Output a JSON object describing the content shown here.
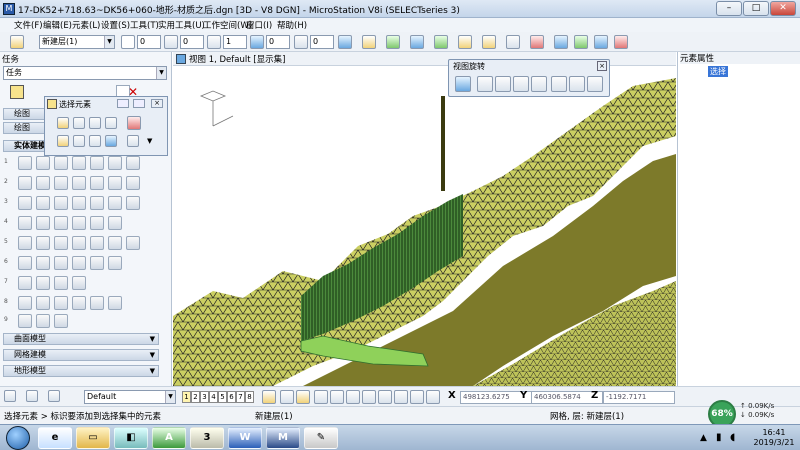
{
  "window": {
    "title": "17-DK52+718.63~DK56+060-地形-材质之后.dgn [3D - V8 DGN] - MicroStation V8i (SELECTseries 3)",
    "min": "–",
    "max": "□",
    "close": "✕"
  },
  "menu": [
    "文件(F)",
    "编辑(E)",
    "元素(L)",
    "设置(S)",
    "工具(T)",
    "实用工具(U)",
    "工作空间(W)",
    "窗口(I)",
    "帮助(H)"
  ],
  "toolbar": {
    "level_combo": "新建层(1)",
    "color_val": "0",
    "style_val": "0",
    "weight_val": "1",
    "transp_val": "0",
    "prio_val": "0"
  },
  "tasks": {
    "header": "任务",
    "combo": "任务",
    "groups": [
      "绘图",
      "绘图",
      "实体建模"
    ],
    "bottom_groups": [
      "曲面模型",
      "网格建模",
      "地形模型"
    ],
    "row_numbers": [
      "1",
      "2",
      "3",
      "4",
      "5",
      "6",
      "7",
      "8",
      "9"
    ]
  },
  "select_palette": {
    "title": "选择元素"
  },
  "rotate_palette": {
    "title": "视图旋转"
  },
  "view": {
    "title": "视图 1, Default [显示集]"
  },
  "properties": {
    "header": "元素属性",
    "selected": "选择"
  },
  "bottom_toolbar": {
    "default_combo": "Default",
    "view_numbers": [
      "1",
      "2",
      "3",
      "4",
      "5",
      "6",
      "7",
      "8"
    ],
    "x_label": "X",
    "x_val": "498123.6275",
    "y_label": "Y",
    "y_val": "460306.5874",
    "z_label": "Z",
    "z_val": "-1192.7171"
  },
  "status": {
    "left": "选择元素 > 标识要添加到选择集中的元素",
    "mid": "新建层(1)",
    "right": "网格, 层: 新建层(1)"
  },
  "tray": {
    "net_pct": "68%",
    "up": "0.09K/s",
    "down": "0.09K/s",
    "time": "16:41",
    "date": "2019/3/21"
  },
  "colors": {
    "terrain": "#c8c85a",
    "roadbed": "#7d7a2a",
    "slope": "#2e6e2e",
    "mesh": "#000000"
  }
}
